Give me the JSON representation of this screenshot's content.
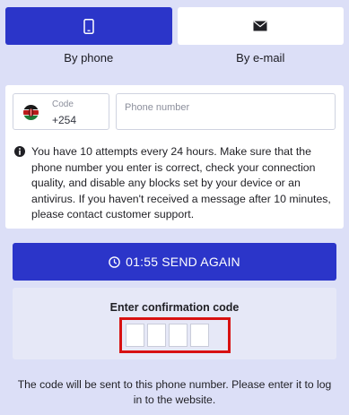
{
  "tabs": [
    {
      "label": "By phone",
      "icon": "phone-icon",
      "active": true
    },
    {
      "label": "By e-mail",
      "icon": "envelope-icon",
      "active": false
    }
  ],
  "form": {
    "country_flag": "kenya-flag-icon",
    "code_label": "Code",
    "code_value": "+254",
    "phone_placeholder": "Phone number",
    "phone_value": ""
  },
  "notice": {
    "icon": "info-icon",
    "text": "You have 10 attempts every 24 hours. Make sure that the phone number you enter is correct, check your connection quality, and disable any blocks set by your device or an antivirus. If you haven't received a message after 10 minutes, please contact customer support."
  },
  "send_again": {
    "icon": "clock-icon",
    "timer": "01:55",
    "label": "SEND AGAIN",
    "full": "01:55 SEND AGAIN"
  },
  "confirmation": {
    "title": "Enter confirmation code",
    "digit_count": 4
  },
  "footer_text": "The code will be sent to this phone number. Please enter it to log in to the website.",
  "colors": {
    "page_background": "#dcdff7",
    "accent": "#2b35c9",
    "highlight_border": "#d81111",
    "confirm_background": "#e6e8f7"
  }
}
